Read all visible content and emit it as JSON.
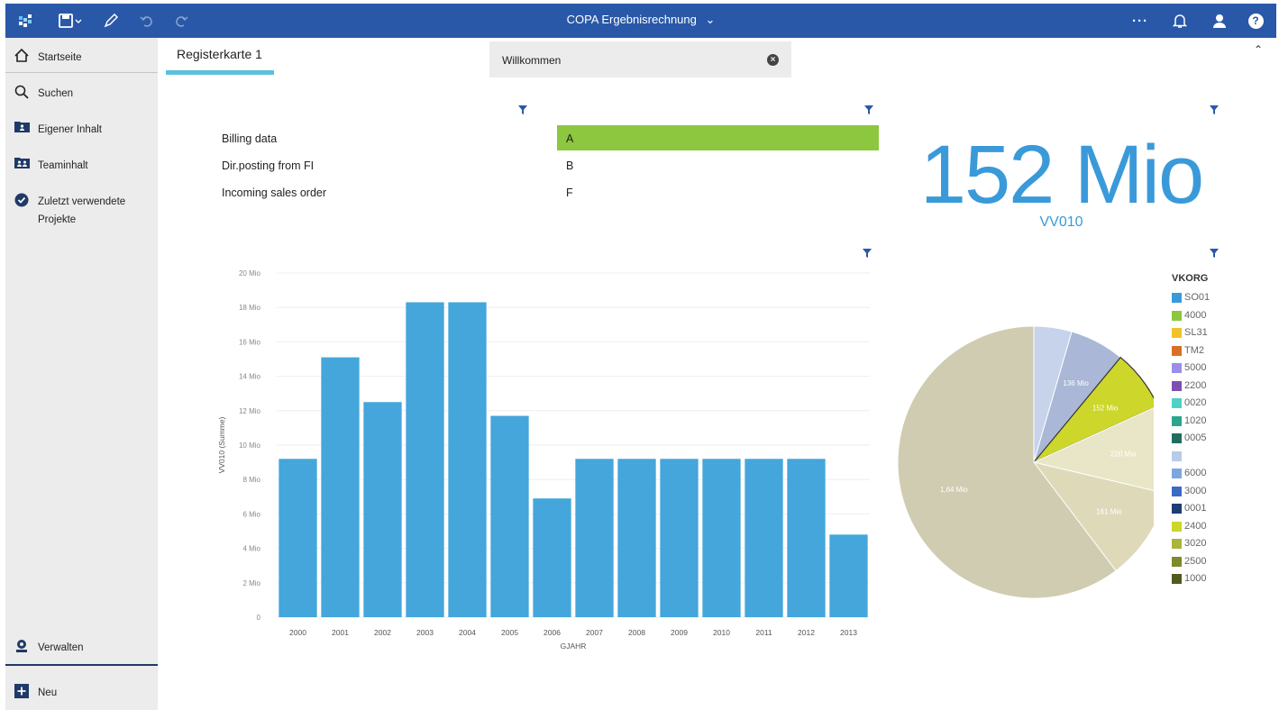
{
  "header": {
    "title": "COPA Ergebnisrechnung",
    "title_chevron": "⌄",
    "icons": [
      "app-switcher-icon",
      "save-icon",
      "pencil-icon",
      "undo-icon",
      "redo-icon",
      "more-icon",
      "bell-icon",
      "user-icon",
      "help-icon"
    ],
    "more_label": "···",
    "help_label": "?"
  },
  "sidebar": {
    "items": [
      {
        "label": "Startseite",
        "icon": "home-icon"
      },
      {
        "label": "Suchen",
        "icon": "search-icon"
      },
      {
        "label": "Eigener Inhalt",
        "icon": "my-content-icon"
      },
      {
        "label": "Teaminhalt",
        "icon": "team-content-icon"
      },
      {
        "label": "Zuletzt verwendete Projekte",
        "icon": "recent-icon"
      }
    ],
    "bottom": [
      {
        "label": "Verwalten",
        "icon": "manage-icon"
      },
      {
        "label": "Neu",
        "icon": "plus-icon"
      }
    ]
  },
  "tabs": [
    {
      "label": "Registerkarte 1",
      "active": true
    },
    {
      "label": "Willkommen",
      "active": false
    }
  ],
  "list_widget": {
    "rows": [
      {
        "name": "Billing data",
        "value": "A",
        "highlighted": true
      },
      {
        "name": "Dir.posting from FI",
        "value": "B",
        "highlighted": false
      },
      {
        "name": "Incoming sales order",
        "value": "F",
        "highlighted": false
      }
    ],
    "highlight_color": "#8dc63f"
  },
  "kpi": {
    "value": "152 Mio",
    "label": "VV010",
    "color": "#3a9ad9"
  },
  "chart_data": [
    {
      "type": "bar",
      "xlabel": "GJAHR",
      "ylabel": "VV010 (Summe)",
      "categories": [
        "2000",
        "2001",
        "2002",
        "2003",
        "2004",
        "2005",
        "2006",
        "2007",
        "2008",
        "2009",
        "2010",
        "2011",
        "2012",
        "2013"
      ],
      "values": [
        9.2,
        15.1,
        12.5,
        18.3,
        18.3,
        11.7,
        6.9,
        9.2,
        9.2,
        9.2,
        9.2,
        9.2,
        9.2,
        4.8
      ],
      "ylim": [
        0,
        20
      ],
      "yticks": [
        "0",
        "2 Mio",
        "4 Mio",
        "6 Mio",
        "8 Mio",
        "10 Mio",
        "12 Mio",
        "14 Mio",
        "16 Mio",
        "18 Mio",
        "20 Mio"
      ],
      "grid": true,
      "color": "#44a6db"
    },
    {
      "type": "pie",
      "legend_title": "VKORG",
      "legend_placement": "right",
      "legend": [
        {
          "name": "SO01",
          "color": "#3a9ad9"
        },
        {
          "name": "4000",
          "color": "#8dc63f"
        },
        {
          "name": "SL31",
          "color": "#f2c22b"
        },
        {
          "name": "TM2",
          "color": "#d96f27"
        },
        {
          "name": "5000",
          "color": "#9b8ee8"
        },
        {
          "name": "2200",
          "color": "#7d4fb0"
        },
        {
          "name": "0020",
          "color": "#4fd1c5"
        },
        {
          "name": "1020",
          "color": "#2ca58d"
        },
        {
          "name": "0005",
          "color": "#1f6e5c"
        },
        {
          "name": "",
          "color": "#b9cbe8"
        },
        {
          "name": "6000",
          "color": "#7ea7e0"
        },
        {
          "name": "3000",
          "color": "#3a6cc4"
        },
        {
          "name": "0001",
          "color": "#1f3d73"
        },
        {
          "name": "2400",
          "color": "#cdd62a"
        },
        {
          "name": "3020",
          "color": "#aab53a"
        },
        {
          "name": "2500",
          "color": "#7e8a2b"
        },
        {
          "name": "1000",
          "color": "#525a1d"
        }
      ],
      "slices": [
        {
          "label": "",
          "value": 4.5,
          "color": "#c7d3ea",
          "highlight": false
        },
        {
          "label": "136 Mio",
          "value": 6.5,
          "color": "#aab7d6",
          "highlight": false
        },
        {
          "label": "152 Mio",
          "value": 7.2,
          "color": "#cdd62a",
          "highlight": true
        },
        {
          "label": "220 Mio",
          "value": 10.5,
          "color": "#e8e6c6",
          "highlight": false
        },
        {
          "label": "161 Mio",
          "value": 11.0,
          "color": "#ded9b9",
          "highlight": false
        },
        {
          "label": "1,64 Mio",
          "value": 60.3,
          "color": "#cfccb1",
          "highlight": false
        }
      ]
    }
  ]
}
